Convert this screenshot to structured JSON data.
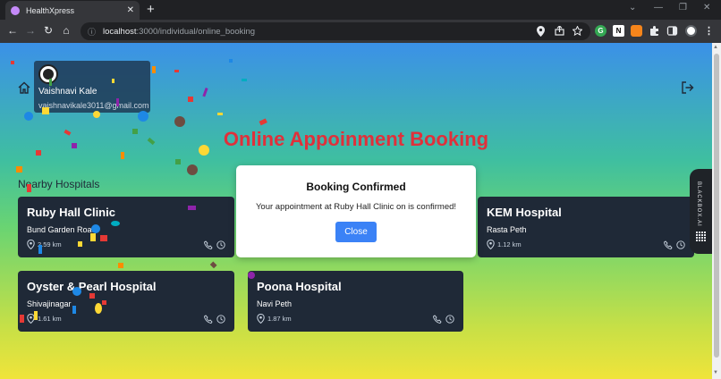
{
  "browser": {
    "tab_title": "HealthXpress",
    "tab_close": "✕",
    "new_tab": "+",
    "url_host": "localhost",
    "url_path": ":3000/individual/online_booking",
    "win_minimize": "⌄",
    "win_min": "—",
    "win_restore": "❐",
    "win_close": "✕",
    "nav_back": "←",
    "nav_forward": "→",
    "nav_reload": "↻",
    "nav_home": "⌂",
    "site_info": "ⓘ",
    "ext_labels": {
      "g": "G",
      "n": "N"
    }
  },
  "user": {
    "name": "Vaishnavi Kale",
    "email": "vaishnavikale3011@gmail.com"
  },
  "page": {
    "title": "Online Appoinment Booking",
    "section_title": "Nearby Hospitals"
  },
  "hospitals": [
    {
      "name": "Ruby Hall Clinic",
      "address": "Bund Garden Road",
      "distance": "2.59 km"
    },
    {
      "name": "KEM Hospital",
      "address": "Rasta Peth",
      "distance": "1.12 km"
    },
    {
      "name": "Oyster & Pearl Hospital",
      "address": "Shivajinagar",
      "distance": "1.61 km"
    },
    {
      "name": "Poona Hospital",
      "address": "Navi Peth",
      "distance": "1.87 km"
    }
  ],
  "modal": {
    "title": "Booking Confirmed",
    "message": "Your appointment at Ruby Hall Clinic on is confirmed!",
    "close_label": "Close"
  },
  "blackbox": {
    "label": "BLACKBOX.AI"
  },
  "colors": {
    "title": "#e0303a",
    "card_bg": "#1f2937",
    "button": "#3b82f6",
    "confetti": [
      "#e53935",
      "#fdd835",
      "#1e88e5",
      "#8e24aa",
      "#43a047",
      "#fb8c00",
      "#00acc1",
      "#6d4c41"
    ]
  }
}
